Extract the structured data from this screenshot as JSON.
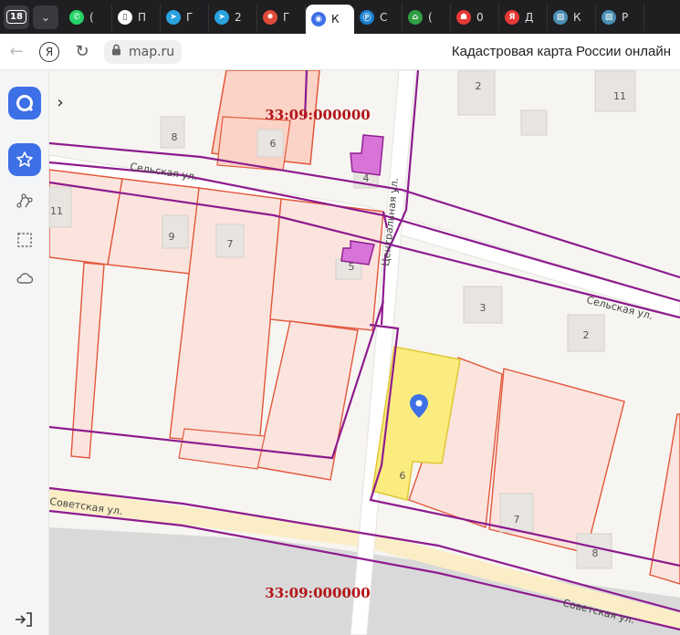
{
  "tabbar": {
    "tab_count": "18",
    "tabs": [
      {
        "icon": "whatsapp-icon",
        "label": "(",
        "color": "#25d366",
        "glyph": "✆"
      },
      {
        "icon": "document-icon",
        "label": "П",
        "color": "#ffffff",
        "glyph": "▯"
      },
      {
        "icon": "telegram-icon",
        "label": "Г",
        "color": "#2aa3df",
        "glyph": "➤"
      },
      {
        "icon": "telegram-icon",
        "label": "2",
        "color": "#2aa3df",
        "glyph": "➤"
      },
      {
        "icon": "colorful-wheel-icon",
        "label": "Г",
        "color": "#e04a3a",
        "glyph": "✸"
      },
      {
        "icon": "map-app-icon",
        "label": "К",
        "color": "#3d6fe6",
        "glyph": "◉",
        "active": true
      },
      {
        "icon": "circle-p-icon",
        "label": "С",
        "color": "#1a7fd0",
        "glyph": "Ⓟ"
      },
      {
        "icon": "green-arrow-icon",
        "label": "(",
        "color": "#2f9e44",
        "glyph": "⌂"
      },
      {
        "icon": "red-badge-icon",
        "label": "0",
        "color": "#e53935",
        "glyph": "☗"
      },
      {
        "icon": "yandex-icon",
        "label": "Д",
        "color": "#e53935",
        "glyph": "Я"
      },
      {
        "icon": "striped-square-icon",
        "label": "К",
        "color": "#4a8fb4",
        "glyph": "▨"
      },
      {
        "icon": "striped-square-icon",
        "label": "Р",
        "color": "#4a8fb4",
        "glyph": "▨"
      }
    ]
  },
  "address": {
    "url": "map.ru",
    "page_title": "Кадастровая карта России онлайн"
  },
  "map": {
    "cadastral_quarter_top": "33:09:000000",
    "cadastral_quarter_bottom": "33:09:000000",
    "street_selskaya_1": "Сельская ул.",
    "street_selskaya_2": "Сельская ул.",
    "street_tsentralnaya": "Центральная ул.",
    "street_sovetskaya_1": "Советская ул.",
    "street_sovetskaya_2": "Советская ул.",
    "houses": {
      "h2_top": "2",
      "h11_top": "11",
      "h8_top": "8",
      "h6_top": "6",
      "h4": "4",
      "h11_left": "11",
      "h9": "9",
      "h7_left": "7",
      "h5": "5",
      "h3": "3",
      "h2_mid": "2",
      "h6_sel": "6",
      "h7_right": "7",
      "h8_right": "8"
    },
    "colors": {
      "parcel_fill": "#fbe4de",
      "parcel_stroke": "#e2573b",
      "boundary": "#8d1c8e",
      "selected_fill": "#fbec7f",
      "building_purple": "#d873d8",
      "marker": "#3d6fe6"
    }
  }
}
